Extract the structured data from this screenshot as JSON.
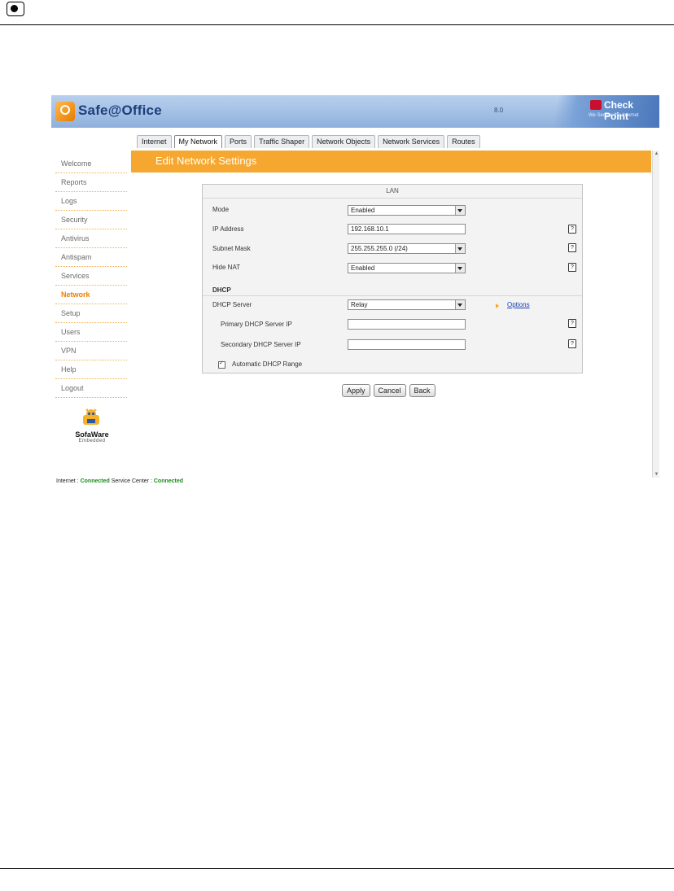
{
  "header": {
    "app_name": "Safe@Office",
    "version": "8.0",
    "vendor": "Check Point",
    "vendor_tagline": "We Secure the Internet"
  },
  "tabs": [
    {
      "label": "Internet",
      "active": false
    },
    {
      "label": "My Network",
      "active": true
    },
    {
      "label": "Ports",
      "active": false
    },
    {
      "label": "Traffic Shaper",
      "active": false
    },
    {
      "label": "Network Objects",
      "active": false
    },
    {
      "label": "Network Services",
      "active": false
    },
    {
      "label": "Routes",
      "active": false
    }
  ],
  "sidebar": {
    "items": [
      {
        "label": "Welcome"
      },
      {
        "label": "Reports"
      },
      {
        "label": "Logs"
      },
      {
        "label": "Security"
      },
      {
        "label": "Antivirus"
      },
      {
        "label": "Antispam"
      },
      {
        "label": "Services"
      },
      {
        "label": "Network",
        "active": true
      },
      {
        "label": "Setup"
      },
      {
        "label": "Users"
      },
      {
        "label": "VPN"
      },
      {
        "label": "Help"
      },
      {
        "label": "Logout"
      }
    ],
    "brand_name": "SofaWare",
    "brand_sub": "Embedded"
  },
  "page": {
    "title": "Edit Network Settings",
    "section_lan": "LAN",
    "section_dhcp": "DHCP"
  },
  "form": {
    "mode": {
      "label": "Mode",
      "value": "Enabled"
    },
    "ip_address": {
      "label": "IP Address",
      "value": "192.168.10.1"
    },
    "subnet_mask": {
      "label": "Subnet Mask",
      "value": "255.255.255.0 (/24)"
    },
    "hide_nat": {
      "label": "Hide NAT",
      "value": "Enabled"
    },
    "dhcp_server": {
      "label": "DHCP Server",
      "value": "Relay",
      "options_link": "Options"
    },
    "primary_dhcp": {
      "label": "Primary DHCP Server IP",
      "value": ""
    },
    "secondary_dhcp": {
      "label": "Secondary DHCP Server IP",
      "value": ""
    },
    "auto_range": {
      "label": "Automatic DHCP Range",
      "checked": true
    },
    "help_glyph": "?"
  },
  "buttons": {
    "apply": "Apply",
    "cancel": "Cancel",
    "back": "Back"
  },
  "status": {
    "internet_label": "Internet :",
    "internet_value": "Connected",
    "service_label": "Service Center :",
    "service_value": "Connected"
  },
  "colors": {
    "accent_orange": "#f6a72f",
    "header_blue": "#8fb0dc",
    "status_green": "#1a8a1a",
    "link_blue": "#1a3fb5"
  },
  "icons": {
    "doc_header": "circle-badge-icon",
    "app_logo": "safe-office-logo-icon",
    "vendor_logo": "check-point-logo-icon",
    "mascot": "sofaware-mascot-icon"
  }
}
